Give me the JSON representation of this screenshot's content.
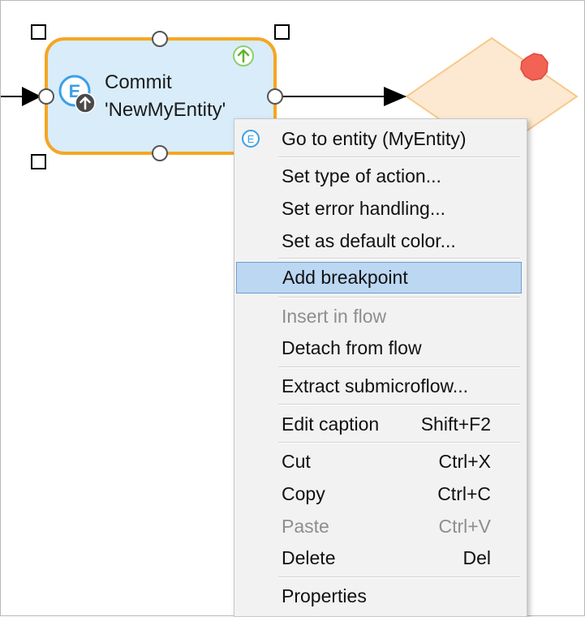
{
  "activity": {
    "caption_line1": "Commit",
    "caption_line2": "'NewMyEntity'",
    "icon_letter": "E"
  },
  "colors": {
    "selection_border": "#f5a623",
    "activity_fill": "#d8ecfa",
    "decision_fill": "#fde9d2",
    "decision_border": "#f7c98b",
    "breakpoint_dot": "#f26255",
    "menu_highlight": "#bcd7f2"
  },
  "context_menu": {
    "goto_entity": {
      "label": "Go to entity (MyEntity)",
      "icon": "entity-icon"
    },
    "set_type": {
      "label": "Set type of action..."
    },
    "set_error": {
      "label": "Set error handling..."
    },
    "set_color": {
      "label": "Set as default color..."
    },
    "add_breakpoint": {
      "label": "Add breakpoint"
    },
    "insert_flow": {
      "label": "Insert in flow"
    },
    "detach_flow": {
      "label": "Detach from flow"
    },
    "extract": {
      "label": "Extract submicroflow..."
    },
    "edit_caption": {
      "label": "Edit caption",
      "shortcut": "Shift+F2"
    },
    "cut": {
      "label": "Cut",
      "shortcut": "Ctrl+X"
    },
    "copy": {
      "label": "Copy",
      "shortcut": "Ctrl+C"
    },
    "paste": {
      "label": "Paste",
      "shortcut": "Ctrl+V"
    },
    "delete": {
      "label": "Delete",
      "shortcut": "Del"
    },
    "properties": {
      "label": "Properties"
    }
  }
}
